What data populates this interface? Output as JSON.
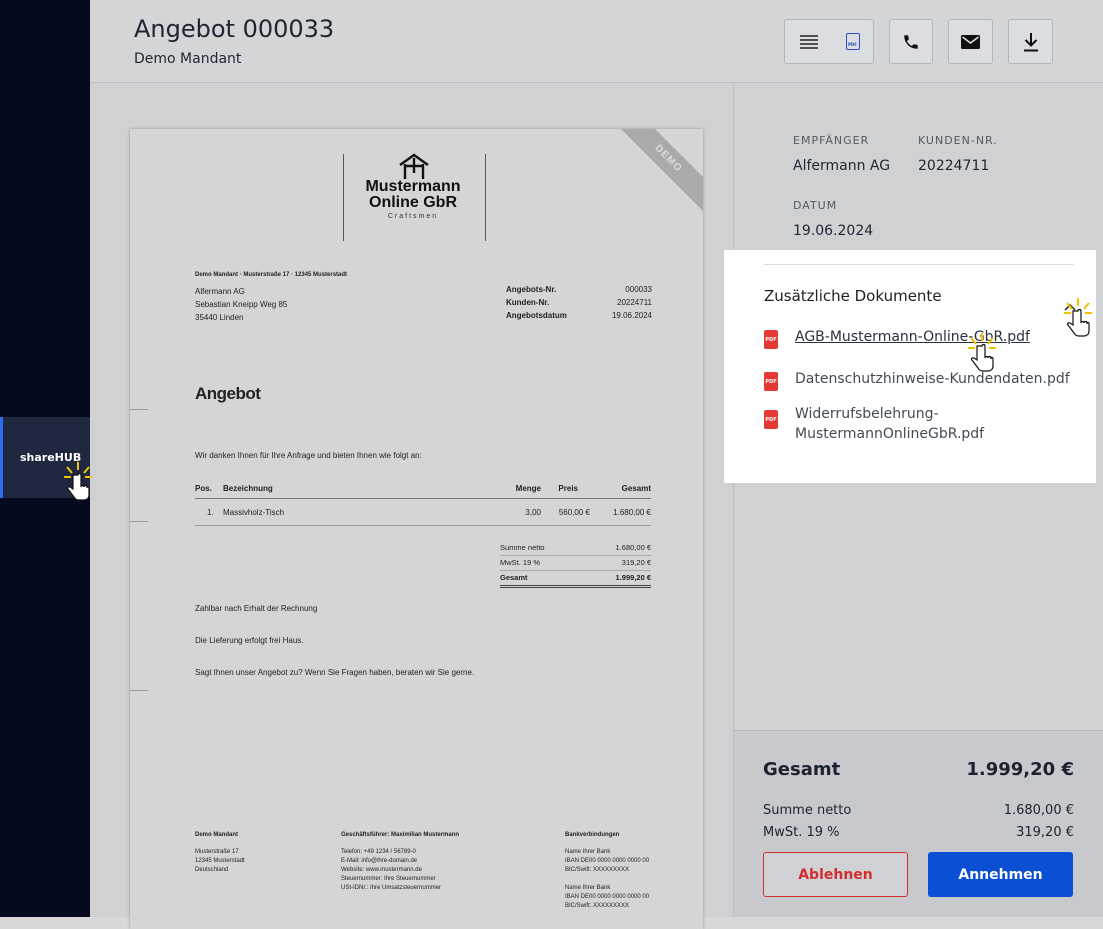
{
  "sidebar": {
    "share_label": "shareHUB"
  },
  "header": {
    "title": "Angebot 000033",
    "subtitle": "Demo Mandant",
    "pdf_badge": "PDF"
  },
  "document": {
    "ribbon": "DEMO",
    "logo_line1": "Mustermann",
    "logo_line2": "Online GbR",
    "logo_tagline": "Craftsmen",
    "sender_line": "Demo Mandant · Musterstraße 17 · 12345 Musterstadt",
    "recipient": [
      "Alfermann AG",
      "Sebastian Kneipp Weg 85",
      "35440 Linden"
    ],
    "meta": [
      [
        "Angebots-Nr.",
        "000033"
      ],
      [
        "Kunden-Nr.",
        "20224711"
      ],
      [
        "Angebotsdatum",
        "19.06.2024"
      ]
    ],
    "heading": "Angebot",
    "intro": "Wir danken Ihnen für Ihre Anfrage und bieten Ihnen wie folgt an:",
    "table_headers": {
      "pos": "Pos.",
      "desc": "Bezeichnung",
      "qty": "Menge",
      "price": "Preis",
      "total": "Gesamt"
    },
    "rows": [
      {
        "pos": "1.",
        "desc": "Massivholz-Tisch",
        "qty": "3,00",
        "price": "560,00 €",
        "total": "1.680,00 €"
      }
    ],
    "sums": [
      [
        "Summe netto",
        "1.680,00 €"
      ],
      [
        "MwSt. 19 %",
        "319,20 €"
      ],
      [
        "Gesamt",
        "1.999,20 €"
      ]
    ],
    "notes": [
      "Zahlbar nach Erhalt der Rechnung",
      "Die Lieferung erfolgt frei Haus.",
      "Sagt Ihnen unser Angebot zu? Wenn Sie Fragen haben, beraten wir Sie gerne."
    ],
    "footer_col1_title": "Demo Mandant",
    "footer_col1": [
      "Musterstraße 17",
      "12345 Musterstadt",
      "Deutschland"
    ],
    "footer_col2_title": "Geschäftsführer: Maximilian Mustermann",
    "footer_col2": [
      "Telefon: +49 1234 / 56789-0",
      "E-Mail: info@ihre-domain.de",
      "Website: www.mustermann.de",
      "Steuernummer: Ihre Steuernummer",
      "USt-IDNr.: Ihre Umsatzsteuernummer"
    ],
    "footer_col3_title": "Bankverbindungen",
    "footer_col3": [
      "Name Ihrer Bank",
      "IBAN DE00 0000 0000 0000 00",
      "BIC/Swift: XXXXXXXXX",
      "",
      "Name Ihrer Bank",
      "IBAN DE00 0000 0000 0000 00",
      "BIC/Swift: XXXXXXXXX"
    ]
  },
  "details": {
    "recipient_label": "EMPFÄNGER",
    "recipient_value": "Alfermann AG",
    "customer_label": "KUNDEN-NR.",
    "customer_value": "20224711",
    "date_label": "DATUM",
    "date_value": "19.06.2024"
  },
  "additional_docs": {
    "title": "Zusätzliche Dokumente",
    "pdf_badge": "PDF",
    "items": [
      {
        "label": "AGB-Mustermann-Online-GbR.pdf"
      },
      {
        "label": "Datenschutzhinweise-Kundendaten.pdf"
      },
      {
        "label": "Widerrufsbelehrung-MustermannOnlineGbR.pdf",
        "line1": "Widerrufsbelehrung-",
        "line2": "MustermannOnlineGbR.pdf"
      }
    ]
  },
  "totals": {
    "total_label": "Gesamt",
    "total_value": "1.999,20 €",
    "net_label": "Summe netto",
    "net_value": "1.680,00 €",
    "vat_label": "MwSt. 19 %",
    "vat_value": "319,20 €",
    "reject_label": "Ablehnen",
    "accept_label": "Annehmen"
  },
  "colors": {
    "accent": "#0a4fd4",
    "reject": "#d32f2f",
    "sidebar": "#050a1f"
  }
}
